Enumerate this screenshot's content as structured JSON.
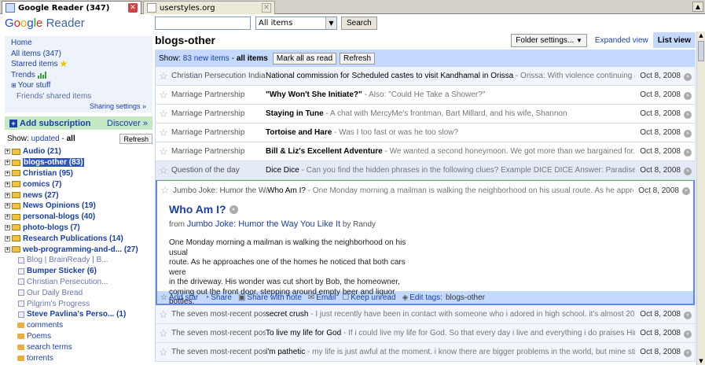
{
  "browser": {
    "tabs": [
      {
        "title": "Google Reader (347)",
        "active": true
      },
      {
        "title": "userstyles.org",
        "active": false
      }
    ]
  },
  "logo": {
    "google": "Google",
    "reader": "Reader"
  },
  "search": {
    "placeholder": "",
    "scope": "All items",
    "button": "Search"
  },
  "sidebar": {
    "nav": {
      "home": "Home",
      "all_items": "All items",
      "all_items_count": "(347)",
      "starred": "Starred items",
      "trends": "Trends",
      "your_stuff": "Your stuff",
      "friends": "Friends' shared items",
      "sharing": "Sharing settings »"
    },
    "add_subscription": "Add subscription",
    "discover": "Discover »",
    "show_label": "Show:",
    "show_updated": "updated",
    "show_all": "all",
    "refresh": "Refresh",
    "subscriptions": [
      {
        "label": "Audio (21)",
        "type": "folder",
        "bold": true
      },
      {
        "label": "blogs-other (83)",
        "type": "folder",
        "bold": true,
        "selected": true
      },
      {
        "label": "Christian (95)",
        "type": "folder",
        "bold": true
      },
      {
        "label": "comics (7)",
        "type": "folder",
        "bold": true
      },
      {
        "label": "news (27)",
        "type": "folder",
        "bold": true
      },
      {
        "label": "News Opinions (19)",
        "type": "folder",
        "bold": true
      },
      {
        "label": "personal-blogs (40)",
        "type": "folder",
        "bold": true
      },
      {
        "label": "photo-blogs (7)",
        "type": "folder",
        "bold": true
      },
      {
        "label": "Research Publications (14)",
        "type": "folder",
        "bold": true
      },
      {
        "label": "web-programming-and-d... (27)",
        "type": "folder",
        "bold": true
      },
      {
        "label": "Blog | BrainReady | B...",
        "type": "feed",
        "bold": false
      },
      {
        "label": "Bumper Sticker (6)",
        "type": "feed",
        "bold": true
      },
      {
        "label": "Christian Persecution...",
        "type": "feed",
        "bold": false
      },
      {
        "label": "Our Daily Bread",
        "type": "feed",
        "bold": false
      },
      {
        "label": "Pilgrim's Progress",
        "type": "feed",
        "bold": false
      },
      {
        "label": "Steve Pavlina's Perso... (1)",
        "type": "feed",
        "bold": true
      },
      {
        "label": "comments",
        "type": "tag",
        "bold": false
      },
      {
        "label": "Poems",
        "type": "tag",
        "bold": false
      },
      {
        "label": "search terms",
        "type": "tag",
        "bold": false
      },
      {
        "label": "torrents",
        "type": "tag",
        "bold": false
      }
    ]
  },
  "main": {
    "title": "blogs-other",
    "folder_settings": "Folder settings...",
    "view_expanded": "Expanded view",
    "view_list": "List view",
    "show_label": "Show:",
    "new_items": "83 new items",
    "separator": "-",
    "all_items": "all items",
    "mark_all_read": "Mark all as read",
    "refresh": "Refresh",
    "entries_top": [
      {
        "source": "Christian Persecution India",
        "title": "National commission for Scheduled castes to visit Kandhamal in Orissa",
        "snippet": " - Orissa: With violence continuing against",
        "date": "Oct 8, 2008",
        "read": true
      },
      {
        "source": "Marriage Partnership",
        "title": "\"Why Won't She Initiate?\"",
        "snippet": " - Also: \"Could He Take a Shower?\"",
        "date": "Oct 8, 2008",
        "read": false
      },
      {
        "source": "Marriage Partnership",
        "title": "Staying in Tune",
        "snippet": " - A chat with MercyMe's frontman, Bart Millard, and his wife, Shannon",
        "date": "Oct 8, 2008",
        "read": false
      },
      {
        "source": "Marriage Partnership",
        "title": "Tortoise and Hare",
        "snippet": " - Was I too fast or was he too slow?",
        "date": "Oct 8, 2008",
        "read": false
      },
      {
        "source": "Marriage Partnership",
        "title": "Bill & Liz's Excellent Adventure",
        "snippet": " - We wanted a second honeymoon. We got more than we bargained for.",
        "date": "Oct 8, 2008",
        "read": false
      },
      {
        "source": "Question of the day",
        "title": "Dice Dice",
        "snippet": " - Can you find the hidden phrases in the following clues? Example DICE DICE Answer: Paradise (Pair of",
        "date": "Oct 8, 2008",
        "read": true
      }
    ],
    "expanded": {
      "source": "Jumbo Joke: Humor the Wa",
      "title": "Who Am I?",
      "snippet": " - One Monday morning a mailman is walking the neighborhood on his usual route. As he approaches",
      "date": "Oct 8, 2008",
      "heading": "Who Am I?",
      "from_label": "from",
      "from_feed": "Jumbo Joke: Humor the Way You Like It",
      "by": "by Randy",
      "body": [
        "One Monday morning a mailman is walking the neighborhood on his usual",
        "route. As he approaches one of the homes he noticed that both cars were",
        "in the driveway. His wonder was cut short by Bob, the homeowner,",
        "coming out the front door, stepping around empty beer and liquor bottles."
      ],
      "actions": {
        "add_star": "Add star",
        "share": "Share",
        "share_note": "Share with note",
        "email": "Email",
        "keep_unread": "Keep unread",
        "edit_tags": "Edit tags:",
        "tags": "blogs-other"
      }
    },
    "entries_bottom": [
      {
        "source": "The seven most-recent pos",
        "title": "secret crush",
        "snippet": " - I just recently have been in contact with someone who i adored in high school. it's almost 20 years",
        "date": "Oct 8, 2008",
        "read": true
      },
      {
        "source": "The seven most-recent pos",
        "title": "To live my life for God",
        "snippet": " - If i could live my life for God. So that every day i live and everything i do praises Him. That",
        "date": "Oct 8, 2008",
        "read": true
      },
      {
        "source": "The seven most-recent pos",
        "title": "i'm pathetic",
        "snippet": " - my life is just awful at the moment. i know there are bigger problems in the world, but mine still",
        "date": "Oct 8, 2008",
        "read": true
      }
    ]
  },
  "colors": {
    "accent_blue": "#c3d9ff",
    "link": "#1a3fa8",
    "add_subscription_bg": "#c3e8c3",
    "selected": "#2d55c8"
  }
}
